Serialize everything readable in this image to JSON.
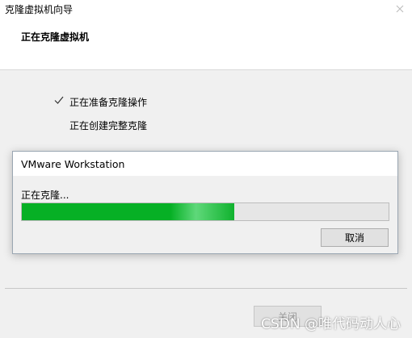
{
  "wizard": {
    "title": "克隆虚拟机向导",
    "header_title": "正在克隆虚拟机",
    "steps": [
      {
        "label": "正在准备克隆操作",
        "completed": true
      },
      {
        "label": "正在创建完整克隆",
        "completed": false
      }
    ],
    "next_label": "关闭",
    "close_icon": "close-icon"
  },
  "modal": {
    "title": "VMware Workstation",
    "status": "正在克隆...",
    "progress": 0.58,
    "cancel_label": "取消"
  },
  "watermark": "CSDN @唯代码动人心",
  "colors": {
    "progress_green": "#06b025",
    "window_bg": "#f0f0f0",
    "header_bg": "#ffffff"
  }
}
